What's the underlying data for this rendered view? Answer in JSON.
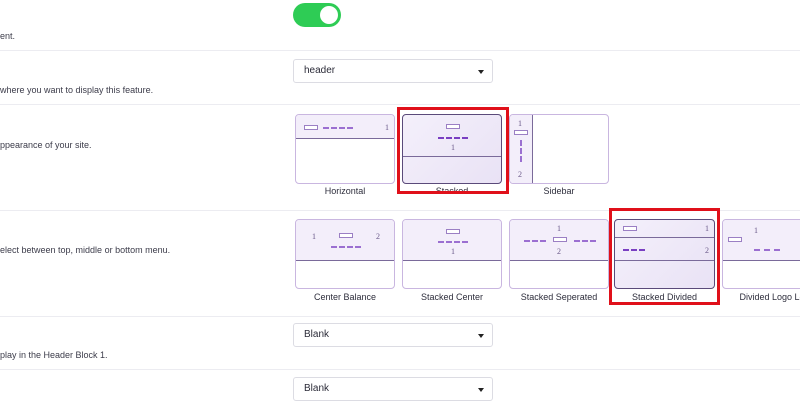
{
  "rows": {
    "enable": {
      "description": "ent."
    },
    "position": {
      "description": "where you want to display this feature.",
      "value": "header"
    },
    "layout": {
      "description": "ppearance of your site.",
      "options": [
        {
          "label": "Horizontal",
          "selected": false,
          "numbers": [
            "1"
          ]
        },
        {
          "label": "Stacked",
          "selected": true,
          "numbers": [
            "1"
          ]
        },
        {
          "label": "Sidebar",
          "selected": false,
          "numbers": [
            "1",
            "2"
          ]
        }
      ]
    },
    "menu_style": {
      "description": "elect between top, middle or bottom menu.",
      "options": [
        {
          "label": "Center Balance",
          "selected": false,
          "numbers": [
            "1",
            "2"
          ]
        },
        {
          "label": "Stacked Center",
          "selected": false,
          "numbers": [
            "1"
          ]
        },
        {
          "label": "Stacked Seperated",
          "selected": false,
          "numbers": [
            "1",
            "2"
          ]
        },
        {
          "label": "Stacked Divided",
          "selected": true,
          "numbers": [
            "1",
            "2"
          ]
        },
        {
          "label": "Divided Logo Le",
          "selected": false,
          "numbers": [
            "1"
          ]
        }
      ]
    },
    "header_block_1": {
      "description": "play in the Header Block 1.",
      "value": "Blank"
    },
    "header_block_2": {
      "value": "Blank"
    }
  },
  "colors": {
    "toggle_on": "#2ecc55",
    "highlight": "#e0101a",
    "card_border": "#c9b6e0",
    "accent_dash": "#9b6fd1"
  },
  "toggle": {
    "state": "on"
  }
}
